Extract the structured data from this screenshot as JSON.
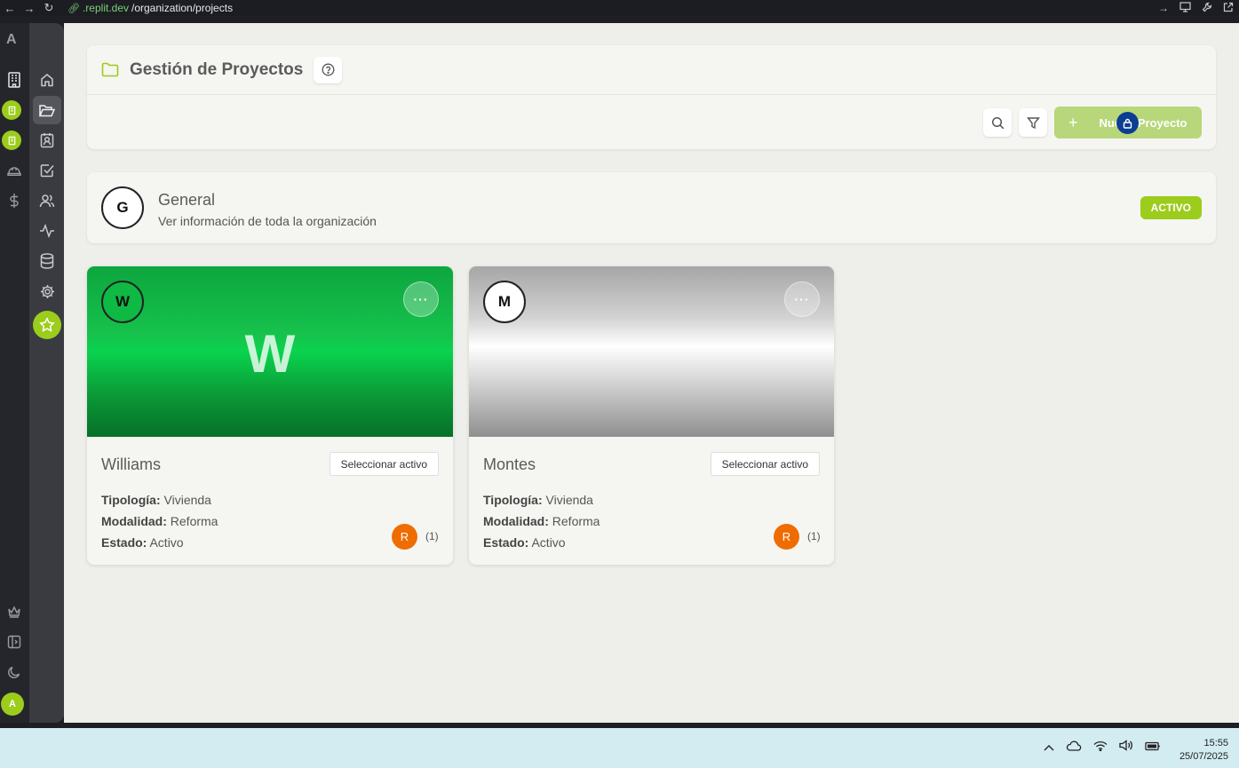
{
  "browser": {
    "url_host": ".replit.dev",
    "url_path": "/organization/projects"
  },
  "rail": {
    "logo": "A",
    "avatar": "A",
    "icons": [
      "building-icon",
      "building-badge-icon",
      "building-badge-icon",
      "hard-hat-icon",
      "dollar-icon",
      "crown-icon",
      "sidebar-toggle-icon",
      "moon-icon"
    ]
  },
  "sidebar": {
    "icons": [
      "home-icon",
      "folder-icon",
      "contacts-icon",
      "checklist-icon",
      "users-icon",
      "activity-icon",
      "database-icon",
      "gear-icon",
      "star-icon"
    ]
  },
  "header": {
    "title": "Gestión de Proyectos",
    "new_project_label": "Nuevo Proyecto"
  },
  "general": {
    "avatar": "G",
    "title": "General",
    "subtitle": "Ver información de toda la organización",
    "status": "ACTIVO"
  },
  "labels": {
    "tipologia": "Tipología:",
    "modalidad": "Modalidad:",
    "estado": "Estado:"
  },
  "projects": [
    {
      "avatar": "W",
      "cover_letter": "W",
      "name": "Williams",
      "select_label": "Seleccionar activo",
      "tipologia": "Vivienda",
      "modalidad": "Reforma",
      "estado": "Activo",
      "member_initial": "R",
      "member_count": "(1)"
    },
    {
      "avatar": "M",
      "cover_letter": "",
      "name": "Montes",
      "select_label": "Seleccionar activo",
      "tipologia": "Vivienda",
      "modalidad": "Reforma",
      "estado": "Activo",
      "member_initial": "R",
      "member_count": "(1)"
    }
  ],
  "taskbar": {
    "time": "15:55",
    "date": "25/07/2025"
  },
  "colors": {
    "accent": "#9ccc1c",
    "lock_badge": "#0b3e93",
    "member_avatar": "#ef6c00"
  }
}
